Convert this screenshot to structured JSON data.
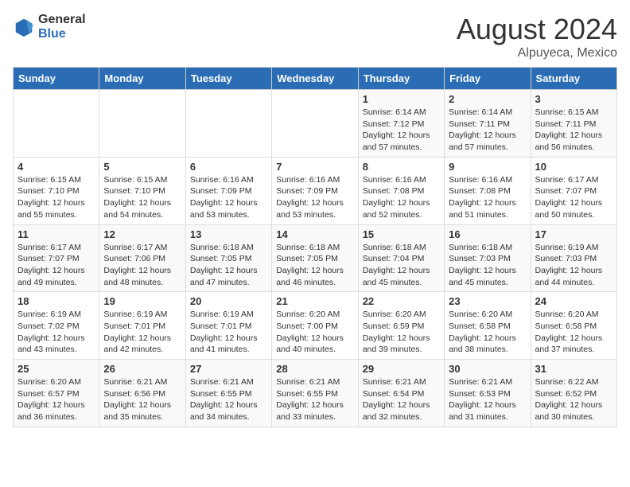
{
  "header": {
    "logo_general": "General",
    "logo_blue": "Blue",
    "title": "August 2024",
    "subtitle": "Alpuyeca, Mexico"
  },
  "days_of_week": [
    "Sunday",
    "Monday",
    "Tuesday",
    "Wednesday",
    "Thursday",
    "Friday",
    "Saturday"
  ],
  "weeks": [
    [
      {
        "day": "",
        "info": ""
      },
      {
        "day": "",
        "info": ""
      },
      {
        "day": "",
        "info": ""
      },
      {
        "day": "",
        "info": ""
      },
      {
        "day": "1",
        "info": "Sunrise: 6:14 AM\nSunset: 7:12 PM\nDaylight: 12 hours\nand 57 minutes."
      },
      {
        "day": "2",
        "info": "Sunrise: 6:14 AM\nSunset: 7:11 PM\nDaylight: 12 hours\nand 57 minutes."
      },
      {
        "day": "3",
        "info": "Sunrise: 6:15 AM\nSunset: 7:11 PM\nDaylight: 12 hours\nand 56 minutes."
      }
    ],
    [
      {
        "day": "4",
        "info": "Sunrise: 6:15 AM\nSunset: 7:10 PM\nDaylight: 12 hours\nand 55 minutes."
      },
      {
        "day": "5",
        "info": "Sunrise: 6:15 AM\nSunset: 7:10 PM\nDaylight: 12 hours\nand 54 minutes."
      },
      {
        "day": "6",
        "info": "Sunrise: 6:16 AM\nSunset: 7:09 PM\nDaylight: 12 hours\nand 53 minutes."
      },
      {
        "day": "7",
        "info": "Sunrise: 6:16 AM\nSunset: 7:09 PM\nDaylight: 12 hours\nand 53 minutes."
      },
      {
        "day": "8",
        "info": "Sunrise: 6:16 AM\nSunset: 7:08 PM\nDaylight: 12 hours\nand 52 minutes."
      },
      {
        "day": "9",
        "info": "Sunrise: 6:16 AM\nSunset: 7:08 PM\nDaylight: 12 hours\nand 51 minutes."
      },
      {
        "day": "10",
        "info": "Sunrise: 6:17 AM\nSunset: 7:07 PM\nDaylight: 12 hours\nand 50 minutes."
      }
    ],
    [
      {
        "day": "11",
        "info": "Sunrise: 6:17 AM\nSunset: 7:07 PM\nDaylight: 12 hours\nand 49 minutes."
      },
      {
        "day": "12",
        "info": "Sunrise: 6:17 AM\nSunset: 7:06 PM\nDaylight: 12 hours\nand 48 minutes."
      },
      {
        "day": "13",
        "info": "Sunrise: 6:18 AM\nSunset: 7:05 PM\nDaylight: 12 hours\nand 47 minutes."
      },
      {
        "day": "14",
        "info": "Sunrise: 6:18 AM\nSunset: 7:05 PM\nDaylight: 12 hours\nand 46 minutes."
      },
      {
        "day": "15",
        "info": "Sunrise: 6:18 AM\nSunset: 7:04 PM\nDaylight: 12 hours\nand 45 minutes."
      },
      {
        "day": "16",
        "info": "Sunrise: 6:18 AM\nSunset: 7:03 PM\nDaylight: 12 hours\nand 45 minutes."
      },
      {
        "day": "17",
        "info": "Sunrise: 6:19 AM\nSunset: 7:03 PM\nDaylight: 12 hours\nand 44 minutes."
      }
    ],
    [
      {
        "day": "18",
        "info": "Sunrise: 6:19 AM\nSunset: 7:02 PM\nDaylight: 12 hours\nand 43 minutes."
      },
      {
        "day": "19",
        "info": "Sunrise: 6:19 AM\nSunset: 7:01 PM\nDaylight: 12 hours\nand 42 minutes."
      },
      {
        "day": "20",
        "info": "Sunrise: 6:19 AM\nSunset: 7:01 PM\nDaylight: 12 hours\nand 41 minutes."
      },
      {
        "day": "21",
        "info": "Sunrise: 6:20 AM\nSunset: 7:00 PM\nDaylight: 12 hours\nand 40 minutes."
      },
      {
        "day": "22",
        "info": "Sunrise: 6:20 AM\nSunset: 6:59 PM\nDaylight: 12 hours\nand 39 minutes."
      },
      {
        "day": "23",
        "info": "Sunrise: 6:20 AM\nSunset: 6:58 PM\nDaylight: 12 hours\nand 38 minutes."
      },
      {
        "day": "24",
        "info": "Sunrise: 6:20 AM\nSunset: 6:58 PM\nDaylight: 12 hours\nand 37 minutes."
      }
    ],
    [
      {
        "day": "25",
        "info": "Sunrise: 6:20 AM\nSunset: 6:57 PM\nDaylight: 12 hours\nand 36 minutes."
      },
      {
        "day": "26",
        "info": "Sunrise: 6:21 AM\nSunset: 6:56 PM\nDaylight: 12 hours\nand 35 minutes."
      },
      {
        "day": "27",
        "info": "Sunrise: 6:21 AM\nSunset: 6:55 PM\nDaylight: 12 hours\nand 34 minutes."
      },
      {
        "day": "28",
        "info": "Sunrise: 6:21 AM\nSunset: 6:55 PM\nDaylight: 12 hours\nand 33 minutes."
      },
      {
        "day": "29",
        "info": "Sunrise: 6:21 AM\nSunset: 6:54 PM\nDaylight: 12 hours\nand 32 minutes."
      },
      {
        "day": "30",
        "info": "Sunrise: 6:21 AM\nSunset: 6:53 PM\nDaylight: 12 hours\nand 31 minutes."
      },
      {
        "day": "31",
        "info": "Sunrise: 6:22 AM\nSunset: 6:52 PM\nDaylight: 12 hours\nand 30 minutes."
      }
    ]
  ]
}
